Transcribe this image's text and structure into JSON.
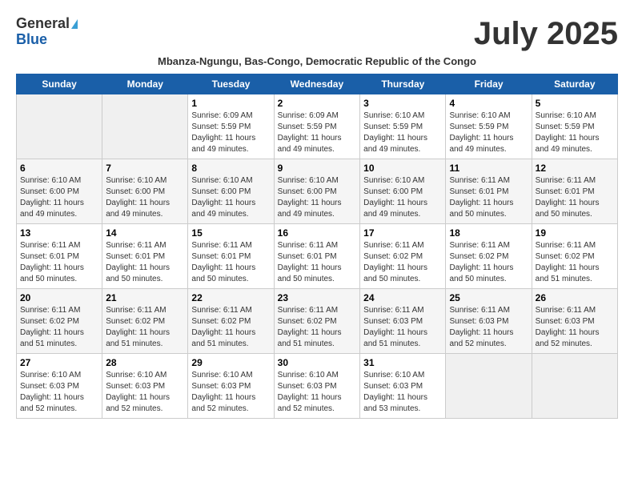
{
  "header": {
    "logo_general": "General",
    "logo_blue": "Blue",
    "month_title": "July 2025",
    "subtitle": "Mbanza-Ngungu, Bas-Congo, Democratic Republic of the Congo"
  },
  "days_of_week": [
    "Sunday",
    "Monday",
    "Tuesday",
    "Wednesday",
    "Thursday",
    "Friday",
    "Saturday"
  ],
  "weeks": [
    [
      {
        "day": "",
        "info": ""
      },
      {
        "day": "",
        "info": ""
      },
      {
        "day": "1",
        "info": "Sunrise: 6:09 AM\nSunset: 5:59 PM\nDaylight: 11 hours and 49 minutes."
      },
      {
        "day": "2",
        "info": "Sunrise: 6:09 AM\nSunset: 5:59 PM\nDaylight: 11 hours and 49 minutes."
      },
      {
        "day": "3",
        "info": "Sunrise: 6:10 AM\nSunset: 5:59 PM\nDaylight: 11 hours and 49 minutes."
      },
      {
        "day": "4",
        "info": "Sunrise: 6:10 AM\nSunset: 5:59 PM\nDaylight: 11 hours and 49 minutes."
      },
      {
        "day": "5",
        "info": "Sunrise: 6:10 AM\nSunset: 5:59 PM\nDaylight: 11 hours and 49 minutes."
      }
    ],
    [
      {
        "day": "6",
        "info": "Sunrise: 6:10 AM\nSunset: 6:00 PM\nDaylight: 11 hours and 49 minutes."
      },
      {
        "day": "7",
        "info": "Sunrise: 6:10 AM\nSunset: 6:00 PM\nDaylight: 11 hours and 49 minutes."
      },
      {
        "day": "8",
        "info": "Sunrise: 6:10 AM\nSunset: 6:00 PM\nDaylight: 11 hours and 49 minutes."
      },
      {
        "day": "9",
        "info": "Sunrise: 6:10 AM\nSunset: 6:00 PM\nDaylight: 11 hours and 49 minutes."
      },
      {
        "day": "10",
        "info": "Sunrise: 6:10 AM\nSunset: 6:00 PM\nDaylight: 11 hours and 49 minutes."
      },
      {
        "day": "11",
        "info": "Sunrise: 6:11 AM\nSunset: 6:01 PM\nDaylight: 11 hours and 50 minutes."
      },
      {
        "day": "12",
        "info": "Sunrise: 6:11 AM\nSunset: 6:01 PM\nDaylight: 11 hours and 50 minutes."
      }
    ],
    [
      {
        "day": "13",
        "info": "Sunrise: 6:11 AM\nSunset: 6:01 PM\nDaylight: 11 hours and 50 minutes."
      },
      {
        "day": "14",
        "info": "Sunrise: 6:11 AM\nSunset: 6:01 PM\nDaylight: 11 hours and 50 minutes."
      },
      {
        "day": "15",
        "info": "Sunrise: 6:11 AM\nSunset: 6:01 PM\nDaylight: 11 hours and 50 minutes."
      },
      {
        "day": "16",
        "info": "Sunrise: 6:11 AM\nSunset: 6:01 PM\nDaylight: 11 hours and 50 minutes."
      },
      {
        "day": "17",
        "info": "Sunrise: 6:11 AM\nSunset: 6:02 PM\nDaylight: 11 hours and 50 minutes."
      },
      {
        "day": "18",
        "info": "Sunrise: 6:11 AM\nSunset: 6:02 PM\nDaylight: 11 hours and 50 minutes."
      },
      {
        "day": "19",
        "info": "Sunrise: 6:11 AM\nSunset: 6:02 PM\nDaylight: 11 hours and 51 minutes."
      }
    ],
    [
      {
        "day": "20",
        "info": "Sunrise: 6:11 AM\nSunset: 6:02 PM\nDaylight: 11 hours and 51 minutes."
      },
      {
        "day": "21",
        "info": "Sunrise: 6:11 AM\nSunset: 6:02 PM\nDaylight: 11 hours and 51 minutes."
      },
      {
        "day": "22",
        "info": "Sunrise: 6:11 AM\nSunset: 6:02 PM\nDaylight: 11 hours and 51 minutes."
      },
      {
        "day": "23",
        "info": "Sunrise: 6:11 AM\nSunset: 6:02 PM\nDaylight: 11 hours and 51 minutes."
      },
      {
        "day": "24",
        "info": "Sunrise: 6:11 AM\nSunset: 6:03 PM\nDaylight: 11 hours and 51 minutes."
      },
      {
        "day": "25",
        "info": "Sunrise: 6:11 AM\nSunset: 6:03 PM\nDaylight: 11 hours and 52 minutes."
      },
      {
        "day": "26",
        "info": "Sunrise: 6:11 AM\nSunset: 6:03 PM\nDaylight: 11 hours and 52 minutes."
      }
    ],
    [
      {
        "day": "27",
        "info": "Sunrise: 6:10 AM\nSunset: 6:03 PM\nDaylight: 11 hours and 52 minutes."
      },
      {
        "day": "28",
        "info": "Sunrise: 6:10 AM\nSunset: 6:03 PM\nDaylight: 11 hours and 52 minutes."
      },
      {
        "day": "29",
        "info": "Sunrise: 6:10 AM\nSunset: 6:03 PM\nDaylight: 11 hours and 52 minutes."
      },
      {
        "day": "30",
        "info": "Sunrise: 6:10 AM\nSunset: 6:03 PM\nDaylight: 11 hours and 52 minutes."
      },
      {
        "day": "31",
        "info": "Sunrise: 6:10 AM\nSunset: 6:03 PM\nDaylight: 11 hours and 53 minutes."
      },
      {
        "day": "",
        "info": ""
      },
      {
        "day": "",
        "info": ""
      }
    ]
  ]
}
